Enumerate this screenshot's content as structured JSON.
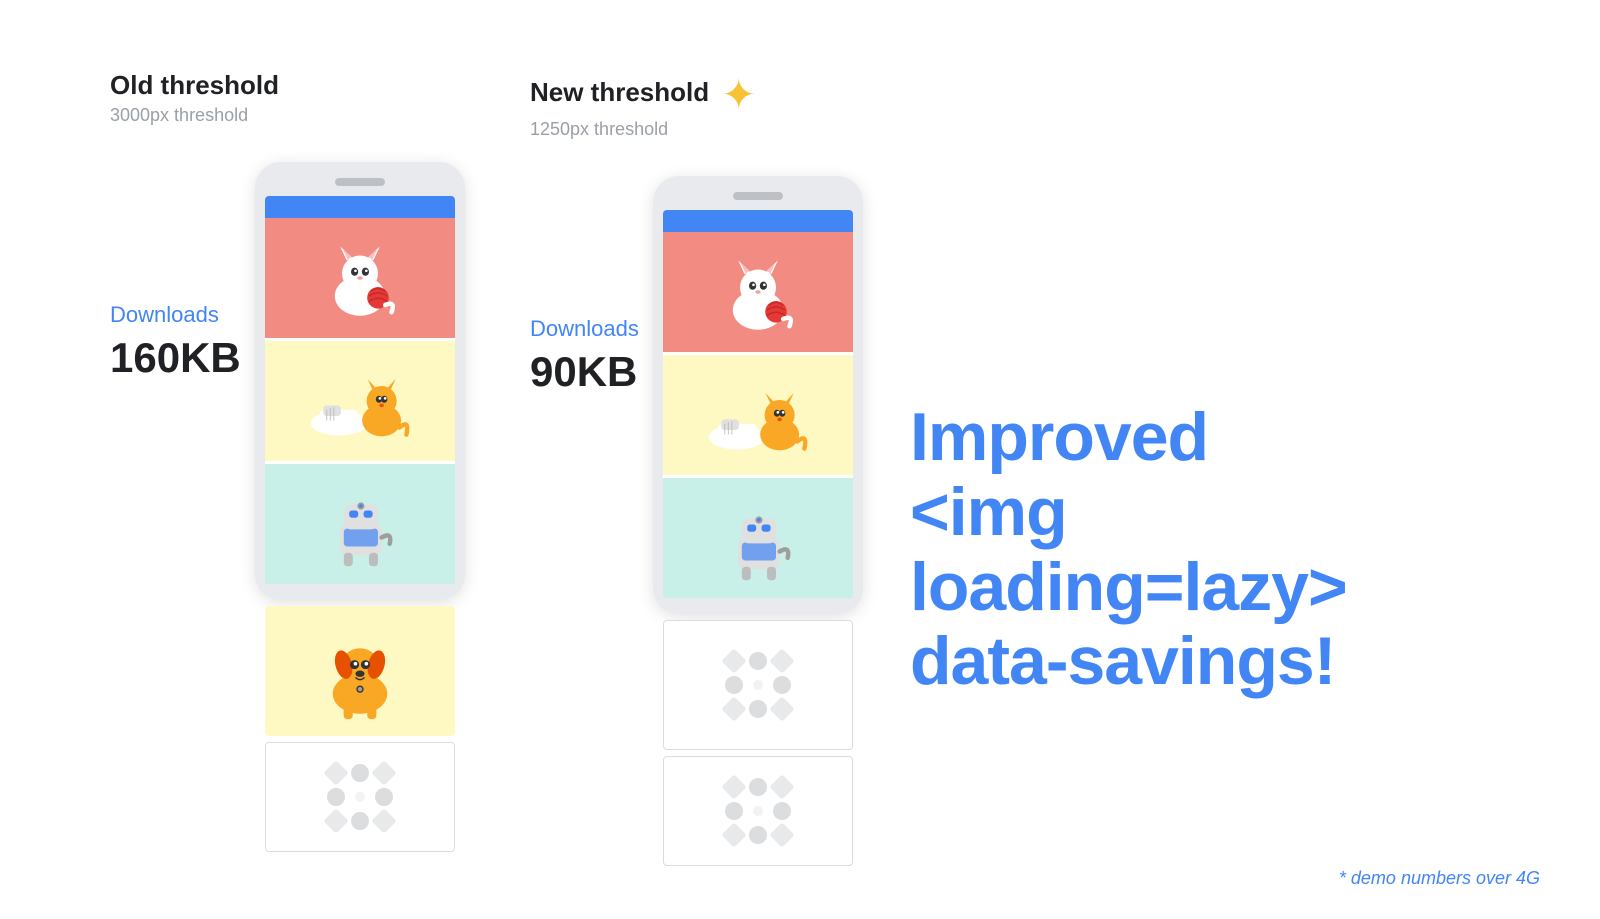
{
  "left_threshold": {
    "title": "Old threshold",
    "subtitle": "3000px threshold",
    "downloads_label": "Downloads",
    "downloads_value": "160KB"
  },
  "right_threshold": {
    "title": "New threshold",
    "subtitle": "1250px threshold",
    "downloads_label": "Downloads",
    "downloads_value": "90KB",
    "sparkle": "✦"
  },
  "hero": {
    "line1": "Improved",
    "line2": "<img loading=lazy>",
    "line3": "data-savings!"
  },
  "footer": {
    "note": "* demo numbers over 4G"
  }
}
